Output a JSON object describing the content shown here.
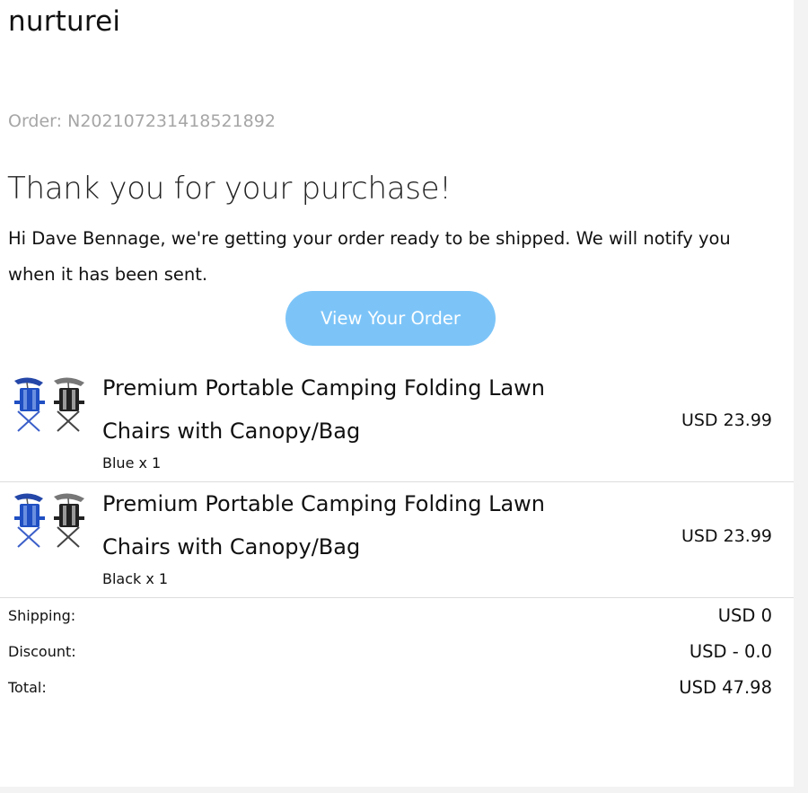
{
  "header": {
    "brand": "nurturei",
    "order_number": "Order: N202107231418521892"
  },
  "main": {
    "headline": "Thank you for your purchase!",
    "message": "Hi Dave Bennage, we're getting your order ready to be shipped. We will notify you when it has been sent.",
    "view_order_label": "View Your Order",
    "button_color": "#7cc4f8"
  },
  "items": [
    {
      "title": "Premium Portable Camping Folding Lawn Chairs with Canopy/Bag",
      "variant": "Blue x 1",
      "price": "USD 23.99",
      "thumbnail": "camping-chairs-icon"
    },
    {
      "title": "Premium Portable Camping Folding Lawn Chairs with Canopy/Bag",
      "variant": "Black x 1",
      "price": "USD 23.99",
      "thumbnail": "camping-chairs-icon"
    }
  ],
  "summary": {
    "shipping_label": "Shipping:",
    "shipping_value": "USD 0",
    "discount_label": "Discount:",
    "discount_value": "USD - 0.0",
    "total_label": "Total:",
    "total_value": "USD 47.98"
  }
}
